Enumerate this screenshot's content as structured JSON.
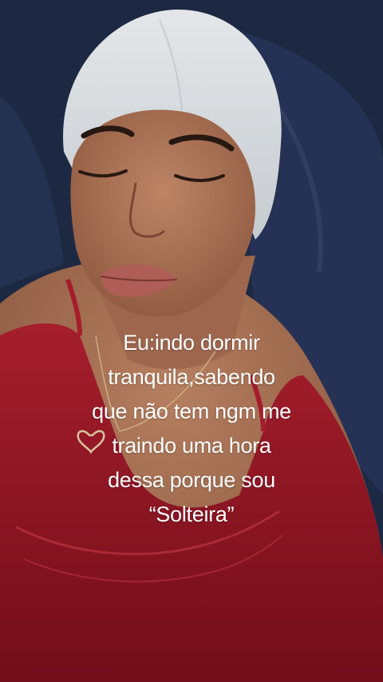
{
  "story": {
    "caption_lines": [
      "Eu:indo dormir",
      "tranquila,sabendo",
      "que não tem ngm me",
      "traindo uma hora",
      "dessa porque sou",
      "“Solteira”"
    ],
    "text_color": "#ffffff"
  },
  "photo": {
    "subjects": [
      "person-lying-on-pillow",
      "white-head-wrap",
      "red-lace-top",
      "heart-necklace",
      "navy-pillow"
    ],
    "colors": {
      "pillow": "#1f2b48",
      "skin": "#b77a5c",
      "head_wrap": "#e8ecef",
      "top": "#a3192a"
    }
  }
}
